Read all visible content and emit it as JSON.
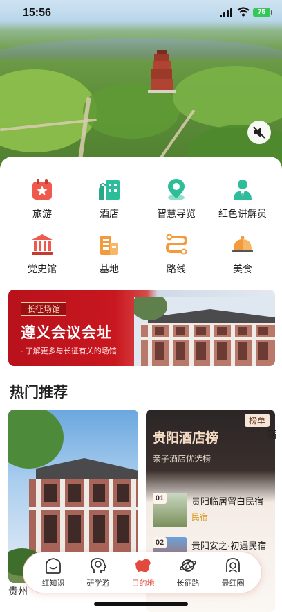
{
  "status": {
    "time": "15:56",
    "battery": "75"
  },
  "categories": [
    {
      "label": "旅游",
      "icon": "calendar-star-icon"
    },
    {
      "label": "酒店",
      "icon": "hotel-icon"
    },
    {
      "label": "智慧导览",
      "icon": "location-pin-icon"
    },
    {
      "label": "红色讲解员",
      "icon": "guide-person-icon"
    },
    {
      "label": "党史馆",
      "icon": "museum-icon"
    },
    {
      "label": "基地",
      "icon": "building-icon"
    },
    {
      "label": "路线",
      "icon": "route-icon"
    },
    {
      "label": "美食",
      "icon": "food-cloche-icon"
    }
  ],
  "banner": {
    "tag": "长征场馆",
    "title": "遵义会议会址",
    "subtitle": "· 了解更多与长征有关的场馆"
  },
  "section_title": "热门推荐",
  "ranking_card": {
    "badge": "榜单",
    "title": "贵阳酒店榜",
    "subtitle": "亲子酒店优选榜",
    "items": [
      {
        "rank": "01",
        "name": "贵阳临居留白民宿",
        "type": "民宿"
      },
      {
        "rank": "02",
        "name": "贵阳安之·初遇民宿",
        "type": ""
      }
    ]
  },
  "left_caption": "贵州",
  "right_caption": "宿",
  "tabs": [
    {
      "label": "红知识",
      "icon": "home-outline-icon",
      "active": false
    },
    {
      "label": "研学游",
      "icon": "brain-study-icon",
      "active": false
    },
    {
      "label": "目的地",
      "icon": "china-map-icon",
      "active": true
    },
    {
      "label": "长征路",
      "icon": "planet-route-icon",
      "active": false
    },
    {
      "label": "最红圈",
      "icon": "people-circle-icon",
      "active": false
    }
  ],
  "colors": {
    "accent": "#e24a3f",
    "teal": "#2dbd9b",
    "orange": "#f39a3c"
  }
}
